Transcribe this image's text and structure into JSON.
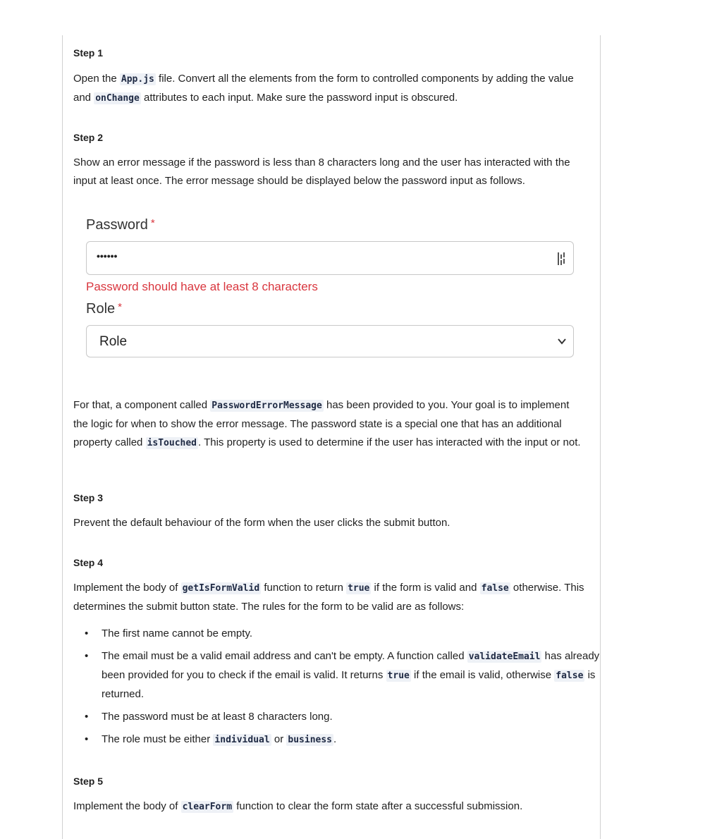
{
  "steps": {
    "s1": {
      "title": "Step 1",
      "p1_a": "Open the ",
      "p1_code1": "App.js",
      "p1_b": " file. Convert all the elements from the form to controlled components by adding the value and ",
      "p1_code2": "onChange",
      "p1_c": " attributes to each input. Make sure the password input is obscured."
    },
    "s2": {
      "title": "Step 2",
      "p1": "Show an error message if the password is less than 8 characters long and the user has interacted with the input at least once. The error message should be displayed below the password input as follows.",
      "p2_a": "For that, a component called ",
      "p2_code1": "PasswordErrorMessage",
      "p2_b": " has been provided to you. Your goal is to implement the logic for when to show the error message. The password state is a special one that has an additional property called ",
      "p2_code2": "isTouched",
      "p2_c": ". This property is used to determine if the user has interacted with the input or not."
    },
    "s3": {
      "title": "Step 3",
      "p1": "Prevent the default behaviour of the form when the user clicks the submit button."
    },
    "s4": {
      "title": "Step 4",
      "p1_a": "Implement the body of ",
      "p1_code1": "getIsFormValid",
      "p1_b": " function to return ",
      "p1_code2": "true",
      "p1_c": " if the form is valid and ",
      "p1_code3": "false",
      "p1_d": " otherwise. This determines the submit button state. The rules for the form to be valid are as follows:",
      "rule1": "The first name cannot be empty.",
      "rule2_a": "The email must be a valid email address and can't be empty. A function called ",
      "rule2_code1": "validateEmail",
      "rule2_b": " has already been provided for you to check if the email is valid. It returns ",
      "rule2_code2": "true",
      "rule2_c": " if the email is valid, otherwise ",
      "rule2_code3": "false",
      "rule2_d": " is returned.",
      "rule3": "The password must be at least 8 characters long.",
      "rule4_a": "The role must be either ",
      "rule4_code1": "individual",
      "rule4_b": " or ",
      "rule4_code2": "business",
      "rule4_c": "."
    },
    "s5": {
      "title": "Step 5",
      "p1_a": "Implement the body of ",
      "p1_code1": "clearForm",
      "p1_b": " function to clear the form state after a successful submission."
    }
  },
  "demo": {
    "password_label": "Password",
    "required_mark": "*",
    "password_value": "••••••",
    "error": "Password should have at least 8 characters",
    "role_label": "Role",
    "role_selected": "Role"
  },
  "colors": {
    "error": "#d9363e",
    "code_bg": "#eef1f6"
  }
}
